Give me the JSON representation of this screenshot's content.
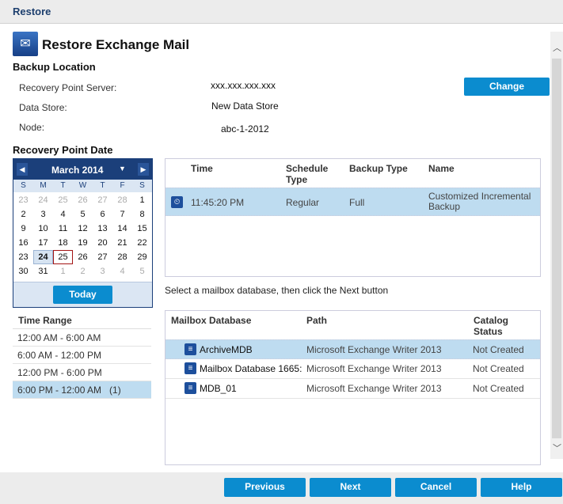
{
  "window_title": "Restore",
  "page_title": "Restore Exchange Mail",
  "backup_location": {
    "heading": "Backup Location",
    "fields": [
      {
        "label": "Recovery Point Server:",
        "value": "xxx.xxx.xxx.xxx"
      },
      {
        "label": "Data Store:",
        "value": "New Data Store"
      },
      {
        "label": "Node:",
        "value": "abc-1-2012"
      }
    ],
    "change_label": "Change"
  },
  "recovery_point_date": {
    "heading": "Recovery Point Date",
    "month": "March 2014",
    "day_names": [
      "S",
      "M",
      "T",
      "W",
      "T",
      "F",
      "S"
    ],
    "days": [
      [
        "23",
        "o"
      ],
      [
        "24",
        "o"
      ],
      [
        "25",
        "o"
      ],
      [
        "26",
        "o"
      ],
      [
        "27",
        "o"
      ],
      [
        "28",
        "o"
      ],
      [
        "1",
        ""
      ],
      [
        "2",
        ""
      ],
      [
        "3",
        ""
      ],
      [
        "4",
        ""
      ],
      [
        "5",
        ""
      ],
      [
        "6",
        ""
      ],
      [
        "7",
        ""
      ],
      [
        "8",
        ""
      ],
      [
        "9",
        ""
      ],
      [
        "10",
        ""
      ],
      [
        "11",
        ""
      ],
      [
        "12",
        ""
      ],
      [
        "13",
        ""
      ],
      [
        "14",
        ""
      ],
      [
        "15",
        ""
      ],
      [
        "16",
        ""
      ],
      [
        "17",
        ""
      ],
      [
        "18",
        ""
      ],
      [
        "19",
        ""
      ],
      [
        "20",
        ""
      ],
      [
        "21",
        ""
      ],
      [
        "22",
        ""
      ],
      [
        "23",
        ""
      ],
      [
        "24",
        "sel"
      ],
      [
        "25",
        "td"
      ],
      [
        "26",
        ""
      ],
      [
        "27",
        ""
      ],
      [
        "28",
        ""
      ],
      [
        "29",
        ""
      ],
      [
        "30",
        ""
      ],
      [
        "31",
        ""
      ],
      [
        "1",
        "o"
      ],
      [
        "2",
        "o"
      ],
      [
        "3",
        "o"
      ],
      [
        "4",
        "o"
      ],
      [
        "5",
        "o"
      ]
    ],
    "today_label": "Today"
  },
  "time_range": {
    "heading": "Time Range",
    "items": [
      "12:00 AM - 6:00 AM",
      "6:00 AM - 12:00 PM",
      "12:00 PM - 6:00 PM",
      "6:00 PM - 12:00 AM   (1)"
    ]
  },
  "recovery_points": {
    "headers": [
      "Time",
      "Schedule Type",
      "Backup Type",
      "Name"
    ],
    "rows": [
      {
        "time": "11:45:20 PM",
        "schedule": "Regular",
        "type": "Full",
        "name": "Customized Incremental Backup"
      }
    ]
  },
  "instruction": "Select a mailbox database, then click the Next button",
  "mailboxes": {
    "headers": [
      "Mailbox Database",
      "Path",
      "Catalog Status"
    ],
    "rows": [
      {
        "name": "ArchiveMDB",
        "path": "Microsoft Exchange Writer 2013",
        "status": "Not Created"
      },
      {
        "name": "Mailbox Database 1665:",
        "path": "Microsoft Exchange Writer 2013",
        "status": "Not Created"
      },
      {
        "name": "MDB_01",
        "path": "Microsoft Exchange Writer 2013",
        "status": "Not Created"
      }
    ]
  },
  "footer": {
    "previous": "Previous",
    "next": "Next",
    "cancel": "Cancel",
    "help": "Help"
  }
}
